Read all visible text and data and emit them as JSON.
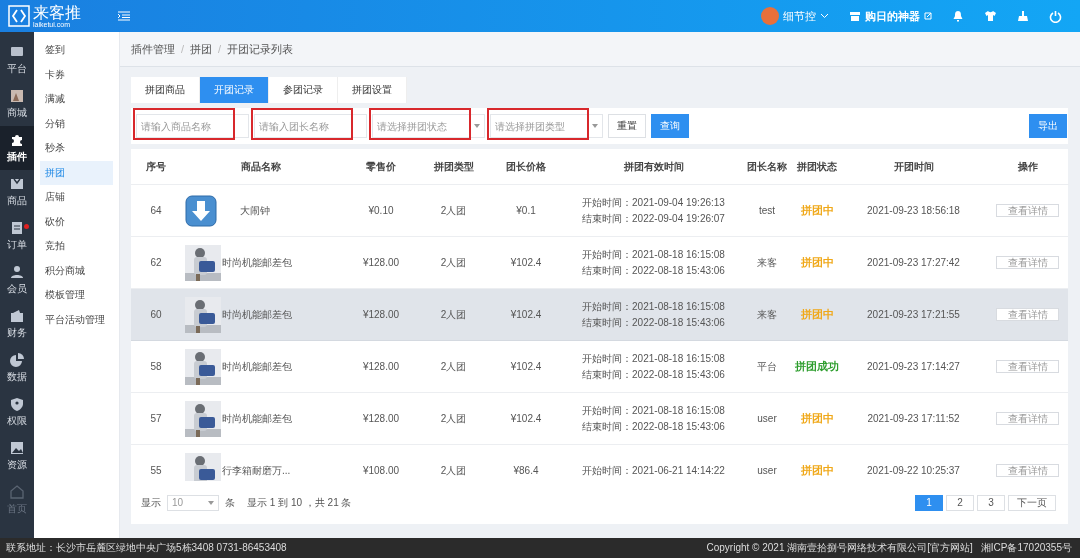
{
  "header": {
    "logo_name": "来客推",
    "logo_domain": "laiketui.com",
    "user_name": "细节控",
    "store_name": "购日的神器"
  },
  "rail": [
    {
      "label": "平台",
      "selected": false,
      "badge": false
    },
    {
      "label": "商城",
      "selected": false,
      "badge": false
    },
    {
      "label": "插件",
      "selected": true,
      "badge": false
    },
    {
      "label": "商品",
      "selected": false,
      "badge": false
    },
    {
      "label": "订单",
      "selected": false,
      "badge": true
    },
    {
      "label": "会员",
      "selected": false,
      "badge": false
    },
    {
      "label": "财务",
      "selected": false,
      "badge": false
    },
    {
      "label": "数据",
      "selected": false,
      "badge": false
    },
    {
      "label": "权限",
      "selected": false,
      "badge": false
    },
    {
      "label": "资源",
      "selected": false,
      "badge": false
    },
    {
      "label": "首页",
      "selected": false,
      "badge": false,
      "disabled": true
    }
  ],
  "submenu": [
    {
      "label": "签到",
      "selected": false
    },
    {
      "label": "卡券",
      "selected": false
    },
    {
      "label": "满减",
      "selected": false
    },
    {
      "label": "分销",
      "selected": false
    },
    {
      "label": "秒杀",
      "selected": false
    },
    {
      "label": "拼团",
      "selected": true
    },
    {
      "label": "店铺",
      "selected": false
    },
    {
      "label": "砍价",
      "selected": false
    },
    {
      "label": "竞拍",
      "selected": false
    },
    {
      "label": "积分商城",
      "selected": false
    },
    {
      "label": "模板管理",
      "selected": false
    },
    {
      "label": "平台活动管理",
      "selected": false
    }
  ],
  "breadcrumb": {
    "items": [
      "插件管理",
      "拼团",
      "开团记录列表"
    ],
    "separator": "/"
  },
  "tabs": [
    {
      "label": "拼团商品",
      "selected": false
    },
    {
      "label": "开团记录",
      "selected": true
    },
    {
      "label": "参团记录",
      "selected": false
    },
    {
      "label": "拼团设置",
      "selected": false
    }
  ],
  "filters": [
    {
      "kind": "input",
      "placeholder": "请输入商品名称",
      "highlighted": true
    },
    {
      "kind": "input",
      "placeholder": "请输入团长名称",
      "highlighted": true
    },
    {
      "kind": "select",
      "placeholder": "请选择拼团状态",
      "highlighted": true
    },
    {
      "kind": "select",
      "placeholder": "请选择拼团类型",
      "highlighted": true
    }
  ],
  "buttons": {
    "reset": "重置",
    "search": "查询",
    "export": "导出"
  },
  "table": {
    "columns": [
      "序号",
      "商品名称",
      "零售价",
      "拼团类型",
      "团长价格",
      "拼团有效时间",
      "团长名称",
      "拼团状态",
      "开团时间",
      "操作"
    ],
    "rows": [
      {
        "id": "64",
        "kind": "icon",
        "product": "大闹钟",
        "price": "¥0.10",
        "type": "2人团",
        "leader_price": "¥0.1",
        "start": "开始时间：2021-09-04 19:26:13",
        "end": "结束时间：2022-09-04 19:26:07",
        "leader": "test",
        "status": "拼团中",
        "color": "#f0a818",
        "open_time": "2021-09-23 18:56:18",
        "action": "查看详情",
        "highlighted": false
      },
      {
        "id": "62",
        "kind": "picture",
        "product": "时尚机能邮差包",
        "price": "¥128.00",
        "type": "2人团",
        "leader_price": "¥102.4",
        "start": "开始时间：2021-08-18 16:15:08",
        "end": "结束时间：2022-08-18 15:43:06",
        "leader": "来客",
        "status": "拼团中",
        "color": "#f0a818",
        "open_time": "2021-09-23 17:27:42",
        "action": "查看详情",
        "highlighted": false
      },
      {
        "id": "60",
        "kind": "picture",
        "product": "时尚机能邮差包",
        "price": "¥128.00",
        "type": "2人团",
        "leader_price": "¥102.4",
        "start": "开始时间：2021-08-18 16:15:08",
        "end": "结束时间：2022-08-18 15:43:06",
        "leader": "来客",
        "status": "拼团中",
        "color": "#f0a818",
        "open_time": "2021-09-23 17:21:55",
        "action": "查看详情",
        "highlighted": true
      },
      {
        "id": "58",
        "kind": "picture",
        "product": "时尚机能邮差包",
        "price": "¥128.00",
        "type": "2人团",
        "leader_price": "¥102.4",
        "start": "开始时间：2021-08-18 16:15:08",
        "end": "结束时间：2022-08-18 15:43:06",
        "leader": "平台",
        "status": "拼团成功",
        "color": "#2e9e2e",
        "open_time": "2021-09-23 17:14:27",
        "action": "查看详情",
        "highlighted": false
      },
      {
        "id": "57",
        "kind": "picture",
        "product": "时尚机能邮差包",
        "price": "¥128.00",
        "type": "2人团",
        "leader_price": "¥102.4",
        "start": "开始时间：2021-08-18 16:15:08",
        "end": "结束时间：2022-08-18 15:43:06",
        "leader": "user",
        "status": "拼团中",
        "color": "#f0a818",
        "open_time": "2021-09-23 17:11:52",
        "action": "查看详情",
        "highlighted": false
      },
      {
        "id": "55",
        "kind": "picture",
        "product": "行李箱耐磨万...",
        "price": "¥108.00",
        "type": "2人团",
        "leader_price": "¥86.4",
        "start": "开始时间：2021-06-21 14:14:22",
        "leader": "user",
        "status": "拼团中",
        "color": "#f0a818",
        "open_time": "2021-09-22 10:25:37",
        "action": "查看详情",
        "highlighted": false
      }
    ]
  },
  "pagination": {
    "show_label": "显示",
    "page_size": "10",
    "unit": "条",
    "summary": "显示 1 到 10 ，共 21 条",
    "pages": [
      {
        "label": "1",
        "selected": true
      },
      {
        "label": "2",
        "selected": false
      },
      {
        "label": "3",
        "selected": false
      }
    ],
    "next": "下一页"
  },
  "footer": {
    "address": "联系地址：长沙市岳麓区绿地中央广场5栋3408 0731-86453408",
    "copyright": "Copyright © 2021 湖南壹拾捌号网络技术有限公司[官方网站]",
    "icp": "湘ICP备17020355号"
  }
}
